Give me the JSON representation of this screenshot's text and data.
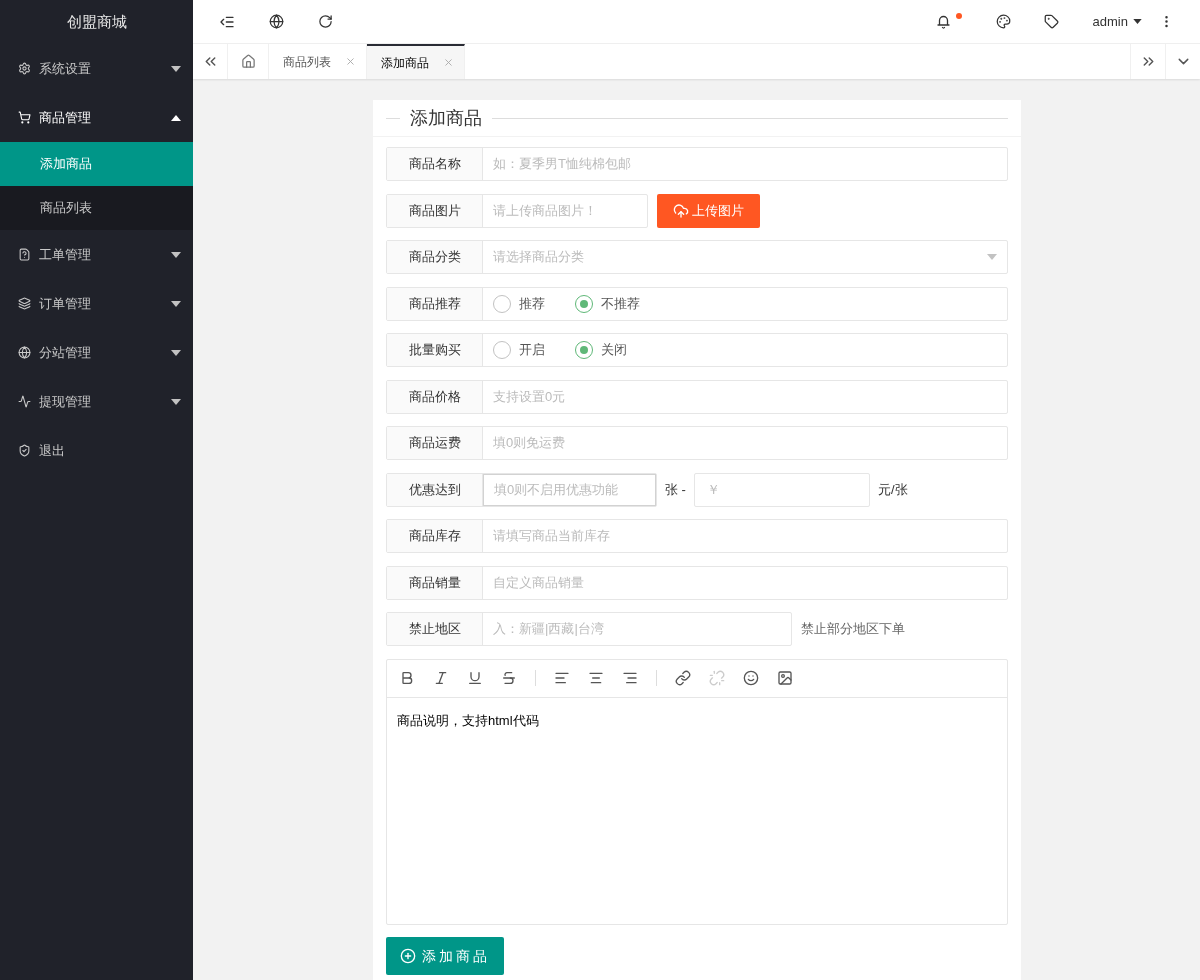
{
  "sidebar": {
    "brand": "创盟商城",
    "items": [
      {
        "label": "系统设置",
        "expanded": false
      },
      {
        "label": "商品管理",
        "expanded": true,
        "children": [
          {
            "label": "添加商品",
            "selected": true
          },
          {
            "label": "商品列表",
            "selected": false
          }
        ]
      },
      {
        "label": "工单管理",
        "expanded": false
      },
      {
        "label": "订单管理",
        "expanded": false
      },
      {
        "label": "分站管理",
        "expanded": false
      },
      {
        "label": "提现管理",
        "expanded": false
      },
      {
        "label": "退出"
      }
    ]
  },
  "header": {
    "notification": {
      "unread": true
    },
    "user": "admin"
  },
  "tabs": [
    {
      "label": "商品列表",
      "selected": false
    },
    {
      "label": "添加商品",
      "selected": true
    }
  ],
  "form": {
    "title": "添加商品",
    "fields": [
      {
        "kind": "text",
        "label": "商品名称",
        "placeholder": "如：夏季男T恤纯棉包邮"
      },
      {
        "kind": "upload",
        "label": "商品图片",
        "placeholder": "请上传商品图片！",
        "button": "上传图片"
      },
      {
        "kind": "select",
        "label": "商品分类",
        "placeholder": "请选择商品分类"
      },
      {
        "kind": "radio",
        "label": "商品推荐",
        "options": [
          {
            "label": "推荐",
            "selected": false
          },
          {
            "label": "不推荐",
            "selected": true
          }
        ]
      },
      {
        "kind": "radio",
        "label": "批量购买",
        "options": [
          {
            "label": "开启",
            "selected": false
          },
          {
            "label": "关闭",
            "selected": true
          }
        ]
      },
      {
        "kind": "text",
        "label": "商品价格",
        "placeholder": "支持设置0元"
      },
      {
        "kind": "text",
        "label": "商品运费",
        "placeholder": "填0则免运费"
      },
      {
        "kind": "range",
        "label": "优惠达到",
        "placeholder": "填0则不启用优惠功能",
        "middle": "张 -",
        "placeholder2": "￥",
        "suffix": "元/张"
      },
      {
        "kind": "text",
        "label": "商品库存",
        "placeholder": "请填写商品当前库存"
      },
      {
        "kind": "text",
        "label": "商品销量",
        "placeholder": "自定义商品销量"
      },
      {
        "kind": "note",
        "label": "禁止地区",
        "placeholder": "入：新疆|西藏|台湾",
        "note": "禁止部分地区下单"
      }
    ],
    "editor": {
      "content": "商品说明，支持html代码"
    },
    "submit": "添加商品"
  }
}
